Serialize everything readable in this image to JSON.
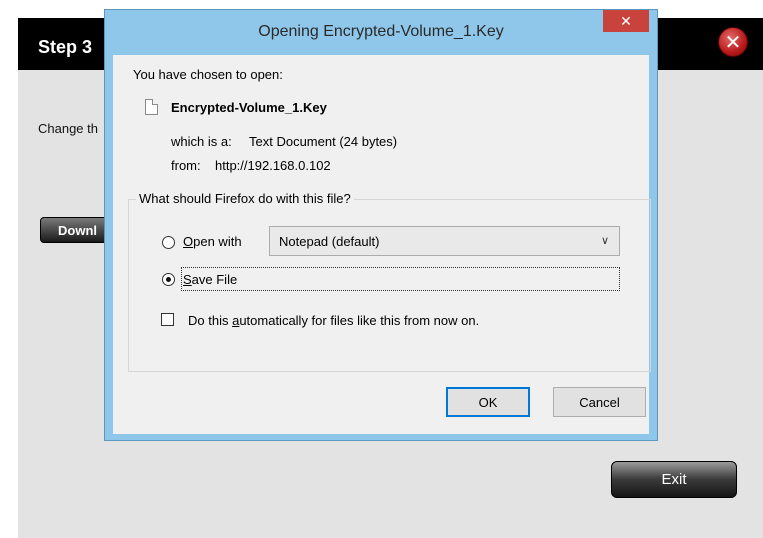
{
  "wizard": {
    "step_title": "Step 3",
    "instruction_text": "Change th",
    "download_label": "Downl",
    "exit_label": "Exit",
    "close_icon": "close-circle-icon"
  },
  "dialog": {
    "title": "Opening Encrypted-Volume_1.Key",
    "close_glyph": "✕",
    "intro": "You have chosen to open:",
    "file_name": "Encrypted-Volume_1.Key",
    "which_is_label": "which is a:",
    "which_is_value": "Text Document (24 bytes)",
    "from_label": "from:",
    "from_value": "http://192.168.0.102",
    "group_label": "What should Firefox do with this file?",
    "open_with": {
      "mnemonic": "O",
      "rest": "pen with",
      "selected": false
    },
    "open_with_app": "Notepad (default)",
    "save_file": {
      "mnemonic": "S",
      "rest": "ave File",
      "selected": true
    },
    "auto_checkbox": {
      "before": "Do this ",
      "mnemonic": "a",
      "after": "utomatically for files like this from now on.",
      "checked": false
    },
    "ok_label": "OK",
    "cancel_label": "Cancel"
  }
}
